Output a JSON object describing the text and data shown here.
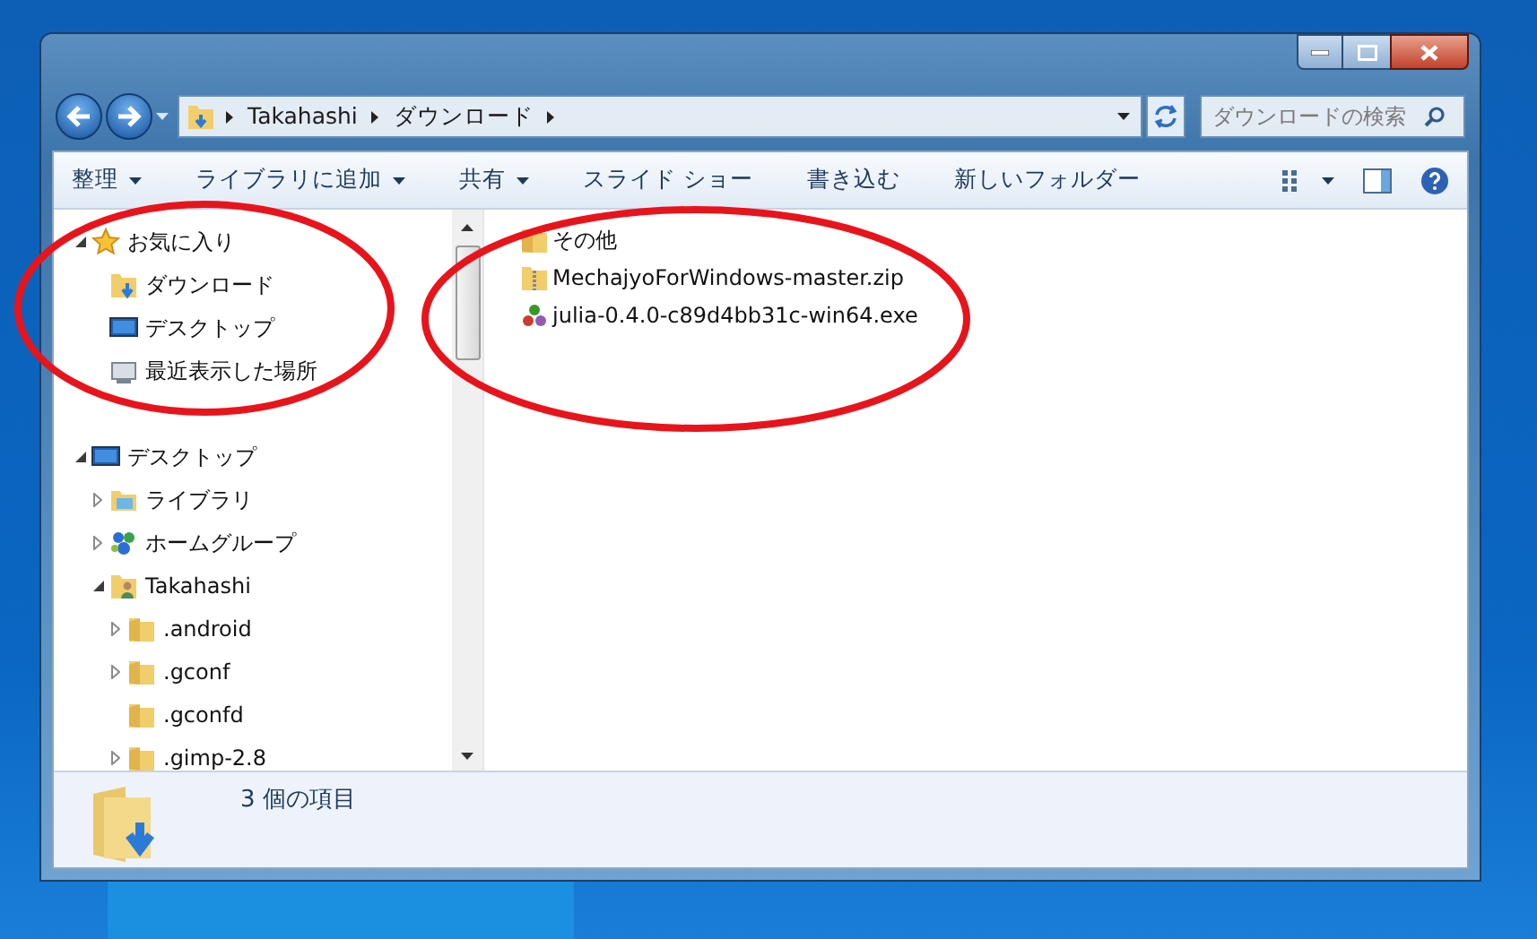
{
  "address_bar": {
    "segments": [
      "Takahashi",
      "ダウンロード"
    ]
  },
  "search": {
    "placeholder": "ダウンロードの検索"
  },
  "toolbar": {
    "items": [
      {
        "label": "整理",
        "dropdown": true
      },
      {
        "label": "ライブラリに追加",
        "dropdown": true
      },
      {
        "label": "共有",
        "dropdown": true
      },
      {
        "label": "スライド ショー",
        "dropdown": false
      },
      {
        "label": "書き込む",
        "dropdown": false
      },
      {
        "label": "新しいフォルダー",
        "dropdown": false
      }
    ]
  },
  "navigation": {
    "groups": [
      {
        "label": "お気に入り",
        "kind": "star",
        "expanded": true,
        "children": [
          {
            "label": "ダウンロード",
            "kind": "download-folder"
          },
          {
            "label": "デスクトップ",
            "kind": "desktop"
          },
          {
            "label": "最近表示した場所",
            "kind": "recent"
          }
        ]
      },
      {
        "label": "デスクトップ",
        "kind": "desktop",
        "expanded": true,
        "children": [
          {
            "label": "ライブラリ",
            "kind": "library",
            "expanded": false
          },
          {
            "label": "ホームグループ",
            "kind": "homegroup",
            "expanded": false
          },
          {
            "label": "Takahashi",
            "kind": "user",
            "expanded": true,
            "children": [
              {
                "label": ".android",
                "kind": "folder",
                "expanded": false
              },
              {
                "label": ".gconf",
                "kind": "folder",
                "expanded": false
              },
              {
                "label": ".gconfd",
                "kind": "folder"
              },
              {
                "label": ".gimp-2.8",
                "kind": "folder",
                "expanded": false
              }
            ]
          }
        ]
      }
    ]
  },
  "files": [
    {
      "name": "その他",
      "kind": "folder"
    },
    {
      "name": "MechajyoForWindows-master.zip",
      "kind": "zip"
    },
    {
      "name": "julia-0.4.0-c89d4bb31c-win64.exe",
      "kind": "julia"
    }
  ],
  "status_bar": {
    "text": "3 個の項目"
  }
}
